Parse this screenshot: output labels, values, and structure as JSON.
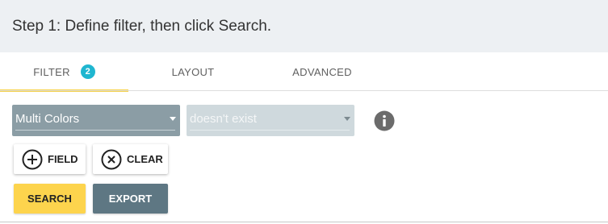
{
  "header": {
    "title": "Step 1: Define filter, then click Search."
  },
  "tabs": [
    {
      "label": "FILTER",
      "badge": "2",
      "active": true
    },
    {
      "label": "LAYOUT"
    },
    {
      "label": "ADVANCED"
    }
  ],
  "filter": {
    "field_select": {
      "value": "Multi Colors"
    },
    "operator_select": {
      "value": "doesn't exist"
    },
    "info_icon": "info-circle-icon"
  },
  "buttons": {
    "field": {
      "label": "FIELD",
      "icon": "plus-circle-icon"
    },
    "clear": {
      "label": "CLEAR",
      "icon": "x-circle-icon"
    },
    "search": {
      "label": "SEARCH"
    },
    "export": {
      "label": "EXPORT"
    }
  },
  "colors": {
    "tab_indicator": "#f6d24a",
    "badge": "#1fb6d0",
    "search_button": "#fdd44d",
    "export_button": "#5e7783",
    "field_select_bg": "#8b9da5",
    "operator_select_bg": "#cfd9dd"
  }
}
